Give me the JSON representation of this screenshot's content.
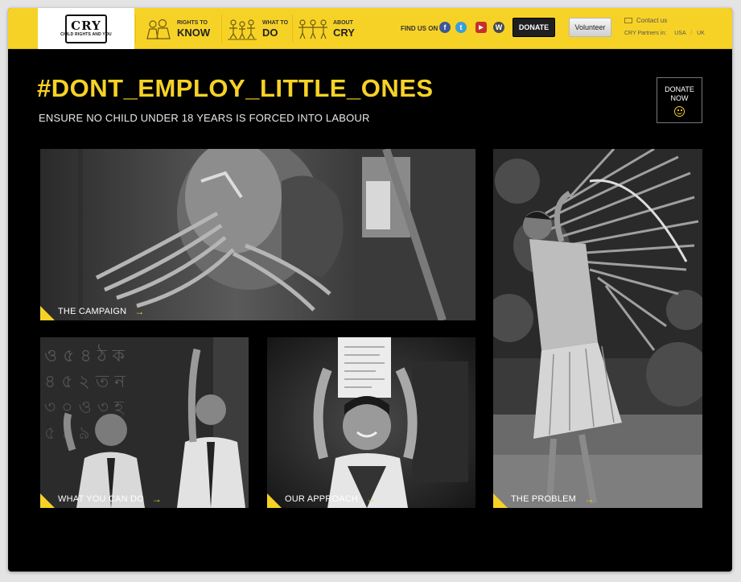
{
  "brand": {
    "logo_mark": "CRY",
    "logo_sub": "CHILD RIGHTS AND YOU"
  },
  "nav": [
    {
      "small": "RIGHTS TO",
      "big": "KNOW",
      "icon": "children-group-icon"
    },
    {
      "small": "WHAT TO",
      "big": "DO",
      "icon": "family-icon"
    },
    {
      "small": "ABOUT",
      "big": "CRY",
      "icon": "people-chain-icon"
    }
  ],
  "social": {
    "label": "FIND US ON",
    "icons": [
      {
        "name": "facebook-icon",
        "glyph": "f",
        "color": "#3b5998"
      },
      {
        "name": "twitter-icon",
        "glyph": "t",
        "color": "#3a9fd8"
      },
      {
        "name": "youtube-icon",
        "glyph": "▶",
        "color": "#c4302b"
      },
      {
        "name": "wordpress-icon",
        "glyph": "W",
        "color": "#4a4a4a"
      }
    ]
  },
  "buttons": {
    "donate": "DONATE",
    "volunteer": "Volunteer"
  },
  "contact": {
    "label": "Contact us"
  },
  "partners": {
    "label": "CRY Partners in:",
    "usa": "USA",
    "uk": "UK"
  },
  "hero": {
    "title": "#DONT_EMPLOY_LITTLE_ONES",
    "subtitle": "ENSURE NO CHILD UNDER 18 YEARS IS FORCED INTO LABOUR",
    "donate_now_line1": "DONATE",
    "donate_now_line2": "NOW"
  },
  "tiles": {
    "campaign": "THE CAMPAIGN",
    "what_you_can_do": "WHAT YOU CAN DO",
    "our_approach": "OUR APPROACH",
    "the_problem": "THE PROBLEM",
    "arrow": "→"
  },
  "colors": {
    "accent": "#f7d226",
    "background": "#000000"
  }
}
